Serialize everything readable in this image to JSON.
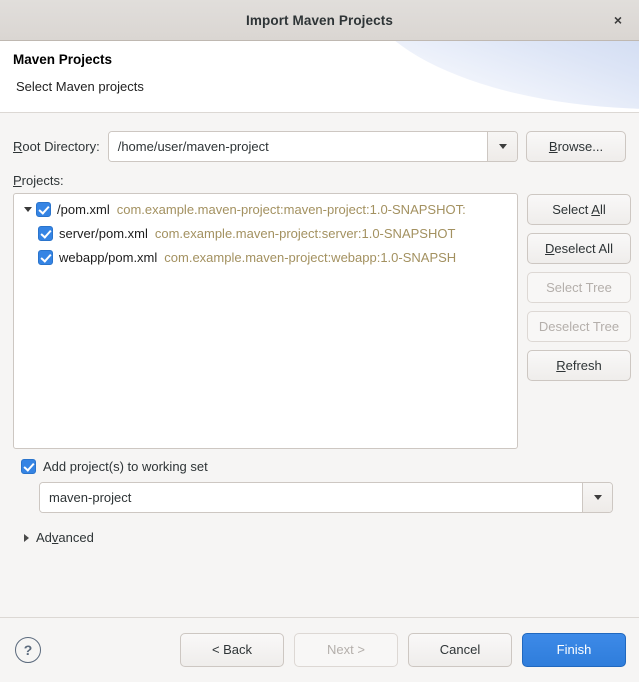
{
  "window": {
    "title": "Import Maven Projects",
    "close_label": "×"
  },
  "header": {
    "title": "Maven Projects",
    "description": "Select Maven projects"
  },
  "root_directory": {
    "label_prefix": "R",
    "label_rest": "oot Directory:",
    "value": "/home/user/maven-project",
    "browse_prefix": "B",
    "browse_rest": "rowse..."
  },
  "projects": {
    "label_prefix": "P",
    "label_rest": "rojects:",
    "rows": [
      {
        "name": "/pom.xml",
        "coords": "com.example.maven-project:maven-project:1.0-SNAPSHOT:",
        "checked": true,
        "indent": false,
        "expander": true
      },
      {
        "name": "server/pom.xml",
        "coords": "com.example.maven-project:server:1.0-SNAPSHOT",
        "checked": true,
        "indent": true,
        "expander": false
      },
      {
        "name": "webapp/pom.xml",
        "coords": "com.example.maven-project:webapp:1.0-SNAPSH",
        "checked": true,
        "indent": true,
        "expander": false
      }
    ]
  },
  "side_buttons": [
    {
      "prefix": "Select ",
      "mnemonic": "A",
      "suffix": "ll",
      "enabled": true
    },
    {
      "prefix": "",
      "mnemonic": "D",
      "suffix": "eselect All",
      "enabled": true
    },
    {
      "prefix": "Select Tree",
      "mnemonic": "",
      "suffix": "",
      "enabled": false
    },
    {
      "prefix": "Deselect Tree",
      "mnemonic": "",
      "suffix": "",
      "enabled": false
    },
    {
      "prefix": "",
      "mnemonic": "R",
      "suffix": "efresh",
      "enabled": true
    }
  ],
  "working_set": {
    "checkbox_label": "Add project(s) to working set",
    "checked": true,
    "value": "maven-project"
  },
  "advanced": {
    "label_prefix": "Ad",
    "label_mnemonic": "v",
    "label_rest": "anced",
    "expanded": false
  },
  "footer": {
    "help_label": "?",
    "back_label": "< Back",
    "next_label": "Next >",
    "cancel_label": "Cancel",
    "finish_label": "Finish",
    "next_enabled": false
  },
  "colors": {
    "accent": "#3584e4",
    "coords_text": "#a39160",
    "window_bg": "#f6f5f4",
    "titlebar_bg": "#dad6d2",
    "disabled_text": "#b4afab"
  }
}
